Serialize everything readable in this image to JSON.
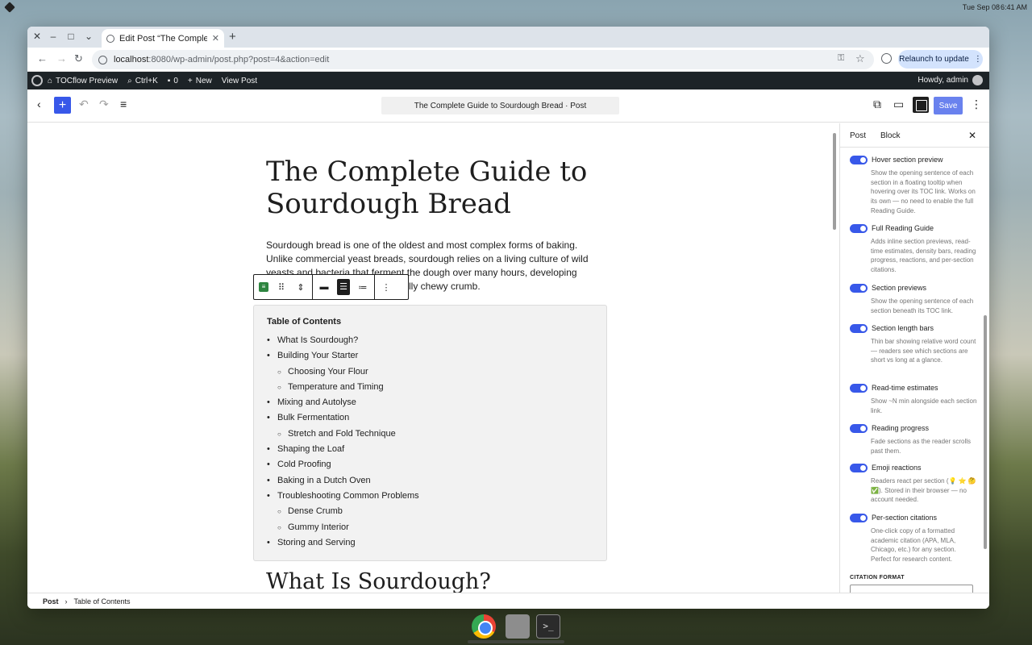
{
  "desktop": {
    "date": "Tue Sep 08",
    "time": "6:41 AM"
  },
  "browser": {
    "tab_title": "Edit Post “The Comple",
    "url_host": "localhost",
    "url_path": ":8080/wp-admin/post.php?post=4&action=edit",
    "relaunch_label": "Relaunch to update"
  },
  "adminbar": {
    "site_name": "TOCflow Preview",
    "search_shortcut": "Ctrl+K",
    "comments_count": "0",
    "new_label": "New",
    "view_post_label": "View Post",
    "howdy": "Howdy, admin"
  },
  "editor_header": {
    "document_title": "The Complete Guide to Sourdough Bread · Post",
    "save_label": "Save"
  },
  "post": {
    "title": "The Complete Guide to Sourdough Bread",
    "intro_line1": "Sourdough bread is one of the oldest and most complex forms of baking.",
    "intro_line2": "Unlike commercial yeast breads, sourdough relies on a living culture of wild",
    "intro_line3": "yeasts and bacteria that ferment the dough over many hours, developing",
    "intro_line4_tail": "lly chewy crumb.",
    "next_heading": "What Is Sourdough?"
  },
  "toc": {
    "heading": "Table of Contents",
    "items": [
      {
        "label": "What Is Sourdough?",
        "level": 1
      },
      {
        "label": "Building Your Starter",
        "level": 1
      },
      {
        "label": "Choosing Your Flour",
        "level": 2
      },
      {
        "label": "Temperature and Timing",
        "level": 2
      },
      {
        "label": "Mixing and Autolyse",
        "level": 1
      },
      {
        "label": "Bulk Fermentation",
        "level": 1
      },
      {
        "label": "Stretch and Fold Technique",
        "level": 2
      },
      {
        "label": "Shaping the Loaf",
        "level": 1
      },
      {
        "label": "Cold Proofing",
        "level": 1
      },
      {
        "label": "Baking in a Dutch Oven",
        "level": 1
      },
      {
        "label": "Troubleshooting Common Problems",
        "level": 1
      },
      {
        "label": "Dense Crumb",
        "level": 2
      },
      {
        "label": "Gummy Interior",
        "level": 2
      },
      {
        "label": "Storing and Serving",
        "level": 1
      }
    ]
  },
  "sidebar": {
    "tab_post": "Post",
    "tab_block": "Block",
    "options": [
      {
        "label": "Hover section preview",
        "help": "Show the opening sentence of each section in a floating tooltip when hovering over its TOC link. Works on its own — no need to enable the full Reading Guide.",
        "enabled": true
      },
      {
        "label": "Full Reading Guide",
        "help": "Adds inline section previews, read-time estimates, density bars, reading progress, reactions, and per-section citations.",
        "enabled": true
      },
      {
        "label": "Section previews",
        "help": "Show the opening sentence of each section beneath its TOC link.",
        "enabled": true
      },
      {
        "label": "Section length bars",
        "help": "Thin bar showing relative word count — readers see which sections are short vs long at a glance.",
        "enabled": true
      },
      {
        "label": "Read-time estimates",
        "help": "Show ~N min alongside each section link.",
        "enabled": true
      },
      {
        "label": "Reading progress",
        "help": "Fade sections as the reader scrolls past them.",
        "enabled": true
      },
      {
        "label": "Emoji reactions",
        "help": "Readers react per section (💡 ⭐ 🤔 ✅). Stored in their browser — no account needed.",
        "enabled": true
      },
      {
        "label": "Per-section citations",
        "help": "One-click copy of a formatted academic citation (APA, MLA, Chicago, etc.) for any section. Perfect for research content.",
        "enabled": true
      }
    ],
    "citation_format_label": "CITATION FORMAT"
  },
  "footer": {
    "crumb_root": "Post",
    "crumb_sep": "›",
    "crumb_current": "Table of Contents"
  },
  "colors": {
    "accent": "#3858e9",
    "admin_bar": "#1d2327"
  }
}
